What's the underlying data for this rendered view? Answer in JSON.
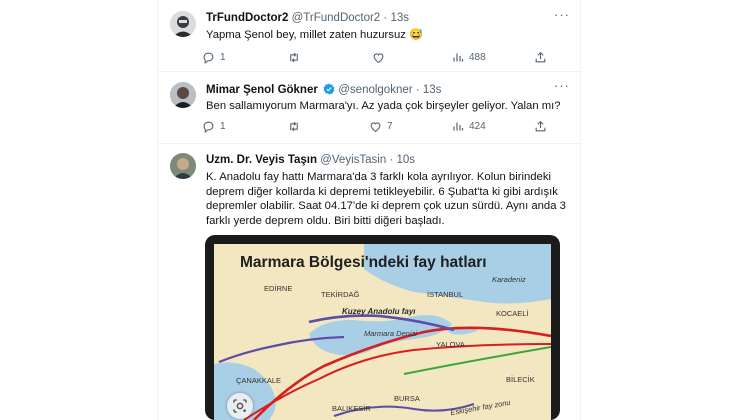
{
  "tweets": [
    {
      "name": "TrFundDoctor2",
      "handle": "@TrFundDoctor2",
      "time": "· 13s",
      "text": "Yapma Şenol bey, millet zaten huzursuz 😅",
      "replies": "1",
      "retweets": "",
      "likes": "",
      "views": "488"
    },
    {
      "name": "Mimar Şenol Gökner",
      "handle": "@senolgokner",
      "time": "· 13s",
      "verified": true,
      "text": "Ben sallamıyorum Marmara'yı. Az yada çok birşeyler geliyor. Yalan mı?",
      "replies": "1",
      "retweets": "",
      "likes": "7",
      "views": "424"
    },
    {
      "name": "Uzm. Dr. Veyis Taşın",
      "handle": "@VeyisTasin",
      "time": "· 10s",
      "lines": [
        "K. Anadolu fay hattı Marmara'da 3 farklı kola ayrılıyor. Kolun birindeki",
        "deprem diğer kollarda ki depremi tetikleyebilir. 6 Şubat'ta ki gibi ardışık",
        "depremler olabilir. Saat 04.17'de ki deprem çok uzun sürdü. Aynı anda 3",
        "farklı yerde deprem oldu. Biri bitti diğeri başladı."
      ]
    }
  ],
  "map": {
    "title": "Marmara Bölgesi'ndeki fay hatları",
    "labels": {
      "karadeniz": "Karadeniz",
      "edirne": "EDİRNE",
      "tekirdag": "TEKİRDAĞ",
      "istanbul": "İSTANBUL",
      "kocaeli": "KOCAELİ",
      "fault": "Kuzey Anadolu fayı",
      "sea": "Marmara Denizi",
      "yalova": "YALOVA",
      "canakkale": "ÇANAKKALE",
      "bilecik": "BİLECİK",
      "bursa": "BURSA",
      "balikesir": "BALIKESİR",
      "eskisehir": "Eskişehir fay zonu"
    }
  },
  "colors": {
    "text": "#0f1419",
    "muted": "#536471",
    "verified": "#1d9bf0",
    "fault_red": "#d81e1e",
    "fault_green": "#3aa63a",
    "fault_purple": "#5b4ea3",
    "sea": "#a9cfe6",
    "land": "#f2e7c0"
  },
  "icons": [
    "reply-icon",
    "retweet-icon",
    "like-icon",
    "views-icon",
    "share-icon",
    "more-icon",
    "verified-badge-icon",
    "google-lens-icon"
  ]
}
